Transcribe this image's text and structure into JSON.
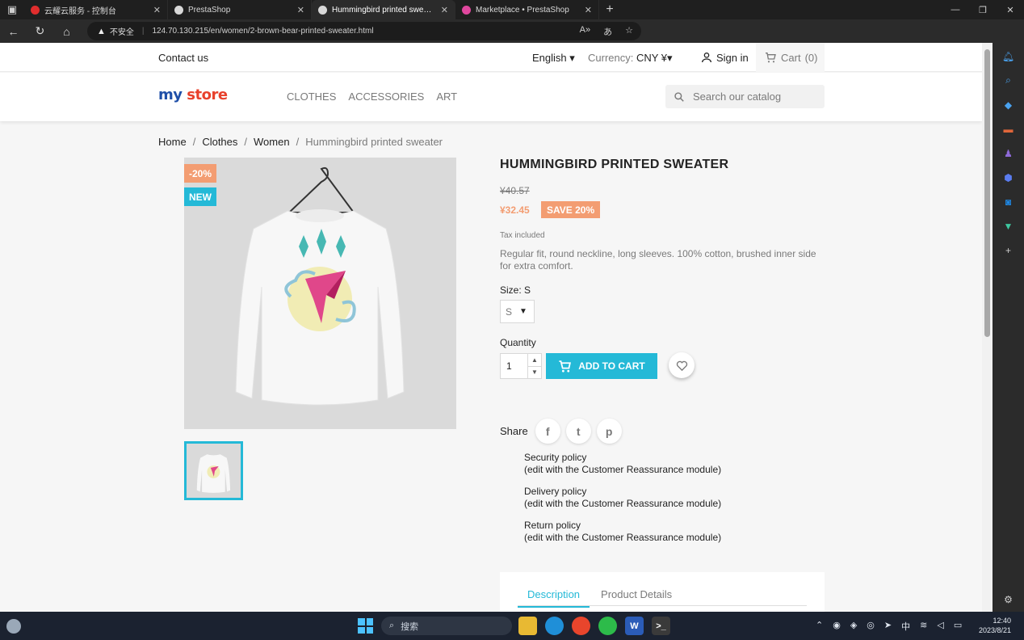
{
  "browser": {
    "tabs": [
      {
        "title": "云耀云服务 - 控制台",
        "favicon_color": "#e02d2d",
        "active": false
      },
      {
        "title": "PrestaShop",
        "favicon_color": "#d8d8d8",
        "active": false
      },
      {
        "title": "Hummingbird printed sweater",
        "favicon_color": "#d8d8d8",
        "active": true
      },
      {
        "title": "Marketplace • PrestaShop",
        "favicon_color": "#e0479e",
        "active": false
      }
    ],
    "new_tab": "+",
    "insecure_label": "不安全",
    "url": "124.70.130.215/en/women/2-brown-bear-printed-sweater.html",
    "window_controls": [
      "—",
      "❐",
      "✕"
    ]
  },
  "header": {
    "contact": "Contact us",
    "language": "English",
    "currency_label": "Currency:",
    "currency_value": "CNY ¥",
    "signin": "Sign in",
    "cart_label": "Cart",
    "cart_count": "(0)"
  },
  "logo": {
    "part1": "my",
    "part2": "store"
  },
  "nav": {
    "items": [
      "CLOTHES",
      "ACCESSORIES",
      "ART"
    ]
  },
  "search": {
    "placeholder": "Search our catalog"
  },
  "breadcrumb": {
    "home": "Home",
    "clothes": "Clothes",
    "women": "Women",
    "current": "Hummingbird printed sweater"
  },
  "product": {
    "flag_discount": "-20%",
    "flag_new": "NEW",
    "title": "HUMMINGBIRD PRINTED SWEATER",
    "regular_price": "¥40.57",
    "price": "¥32.45",
    "save": "SAVE 20%",
    "tax": "Tax included",
    "description": "Regular fit, round neckline, long sleeves. 100% cotton, brushed inner side for extra comfort.",
    "size_label": "Size: S",
    "size_value": "S",
    "quantity_label": "Quantity",
    "quantity_value": "1",
    "add_to_cart": "ADD TO CART",
    "share_label": "Share"
  },
  "reassurance": [
    {
      "title": "Security policy",
      "sub": "(edit with the Customer Reassurance module)"
    },
    {
      "title": "Delivery policy",
      "sub": "(edit with the Customer Reassurance module)"
    },
    {
      "title": "Return policy",
      "sub": "(edit with the Customer Reassurance module)"
    }
  ],
  "tabs": {
    "description": "Description",
    "details": "Product Details"
  },
  "taskbar": {
    "search_placeholder": "搜索",
    "ime": "中",
    "time": "12:40",
    "date": "2023/8/21"
  },
  "colors": {
    "accent": "#24b9d7",
    "discount": "#f39d72",
    "page_bg": "#f6f6f6"
  }
}
